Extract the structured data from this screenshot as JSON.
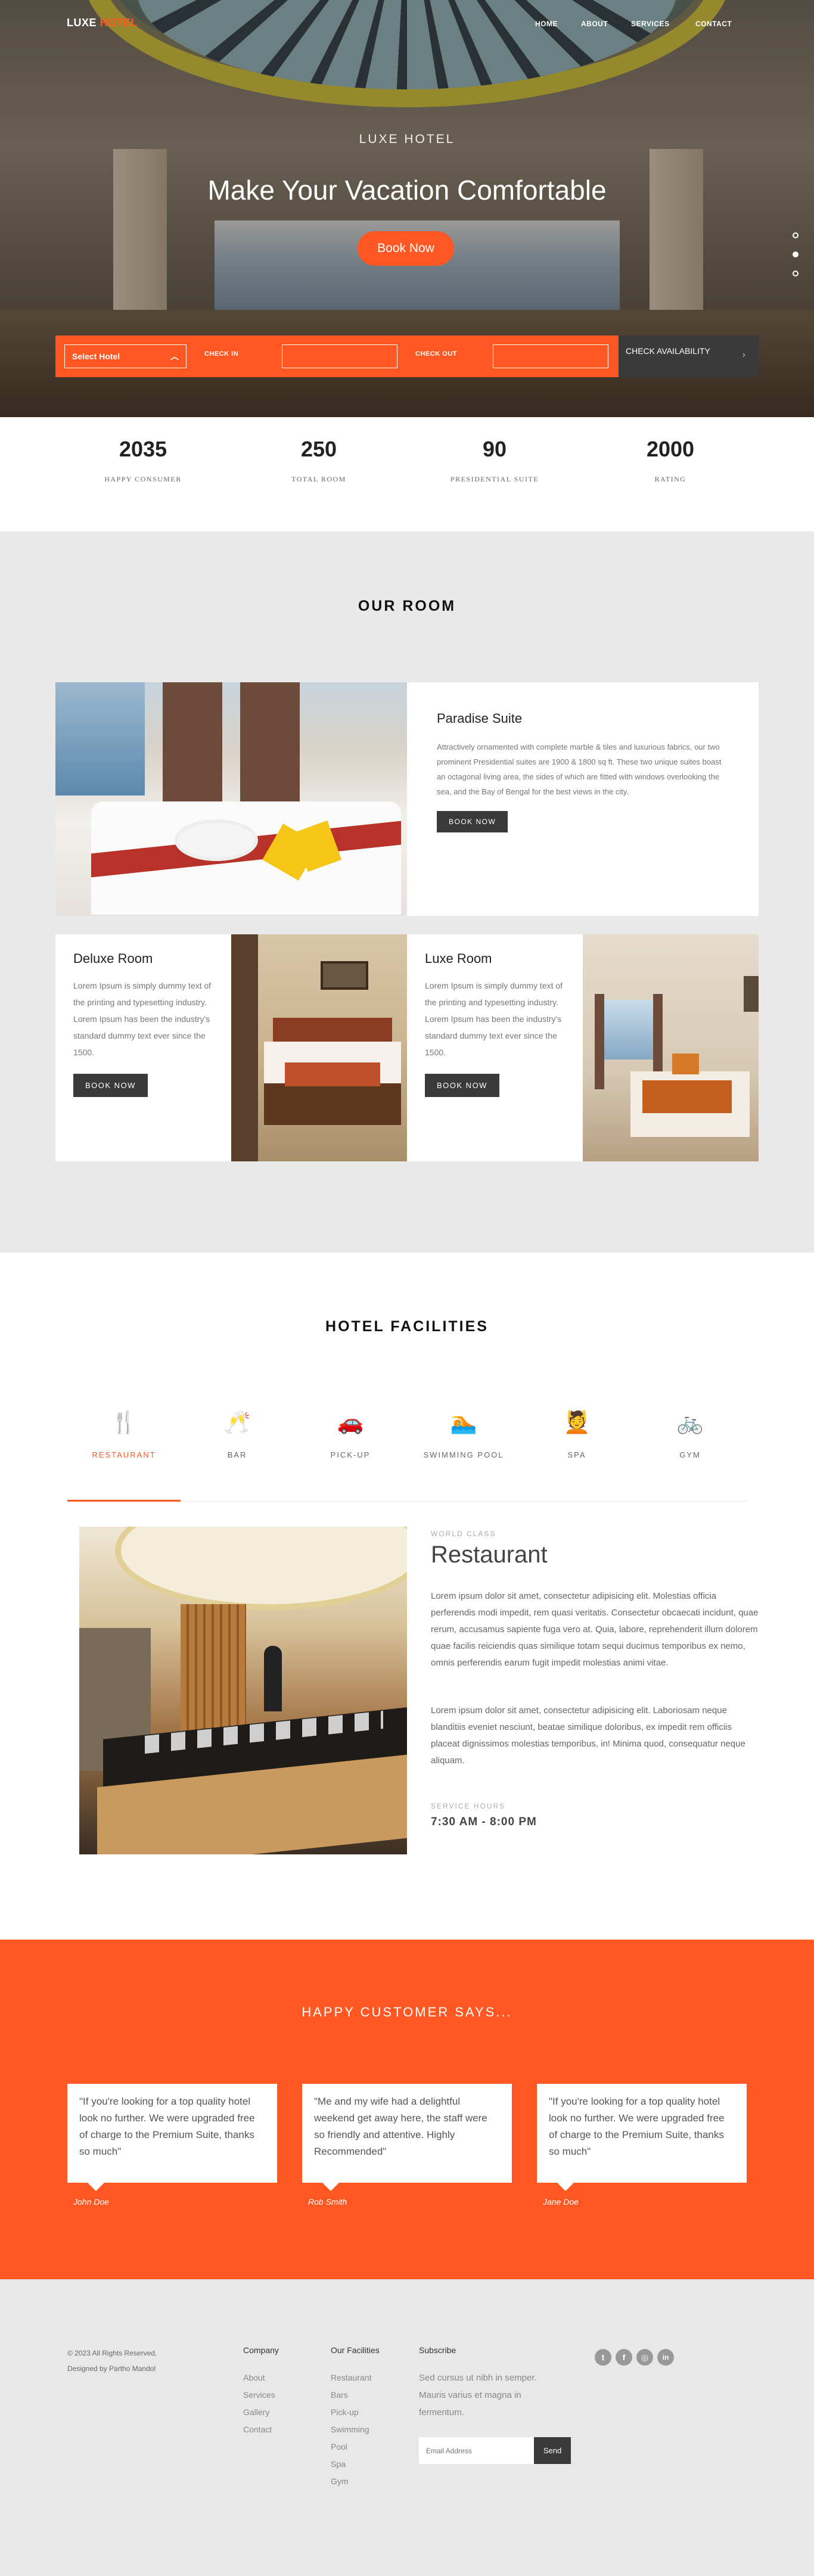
{
  "brand": {
    "name_part1": "LUXE",
    "name_part2": "HOTEL",
    "accent": "#ff5722",
    "dark": "#3a3a3a"
  },
  "nav": {
    "items": [
      "HOME",
      "ABOUT",
      "SERVICES",
      "CONTACT"
    ]
  },
  "hero": {
    "subtitle": "LUXE HOTEL",
    "title": "Make Your Vacation Comfortable",
    "cta": "Book Now",
    "slide_dots": 3,
    "active_dot": 2
  },
  "booking": {
    "select_hotel": "Select Hotel",
    "check_in_label": "CHECK IN",
    "check_out_label": "CHECK OUT",
    "check_availability": "CHECK AVAILABILITY"
  },
  "stats": [
    {
      "value": "2035",
      "label": "HAPPY CONSUMER"
    },
    {
      "value": "250",
      "label": "TOTAL ROOM"
    },
    {
      "value": "90",
      "label": "PRESIDENTIAL SUITE"
    },
    {
      "value": "2000",
      "label": "RATING"
    }
  ],
  "rooms": {
    "title": "OUR ROOM",
    "featured": {
      "name": "Paradise Suite",
      "desc": "Attractively ornamented with complete marble & tiles and luxurious fabrics, our two prominent Presidential suites are 1900 & 1800 sq ft. These two unique suites boast an octagonal living area, the sides of which are fitted with windows overlooking the sea, and the Bay of Bengal for the best views in the city.",
      "button": "BOOK NOW"
    },
    "items": [
      {
        "name": "Deluxe Room",
        "desc": "Lorem Ipsum is simply dummy text of the printing and typesetting industry. Lorem Ipsum has been the industry's standard dummy text ever since the 1500.",
        "button": "BOOK NOW"
      },
      {
        "name": "Luxe Room",
        "desc": "Lorem Ipsum is simply dummy text of the printing and typesetting industry. Lorem Ipsum has been the industry's standard dummy text ever since the 1500.",
        "button": "BOOK NOW"
      }
    ]
  },
  "facilities": {
    "title": "HOTEL FACILITIES",
    "tabs": [
      {
        "label": "RESTAURANT",
        "icon": "utensils-icon",
        "glyph": "🍴"
      },
      {
        "label": "BAR",
        "icon": "cheers-icon",
        "glyph": "🥂"
      },
      {
        "label": "PICK-UP",
        "icon": "car-icon",
        "glyph": "🚗"
      },
      {
        "label": "SWIMMING POOL",
        "icon": "swimmer-icon",
        "glyph": "🏊"
      },
      {
        "label": "SPA",
        "icon": "spa-icon",
        "glyph": "💆"
      },
      {
        "label": "GYM",
        "icon": "exercise-bike-icon",
        "glyph": "🚲"
      }
    ],
    "active_tab": 0,
    "detail": {
      "eyebrow": "WORLD CLASS",
      "title": "Restaurant",
      "p1": "Lorem ipsum dolor sit amet, consectetur adipisicing elit. Molestias officia perferendis modi impedit, rem quasi veritatis. Consectetur obcaecati incidunt, quae rerum, accusamus sapiente fuga vero at. Quia, labore, reprehenderit illum dolorem quae facilis reiciendis quas similique totam sequi ducimus temporibus ex nemo, omnis perferendis earum fugit impedit molestias animi vitae.",
      "p2": "Lorem ipsum dolor sit amet, consectetur adipisicing elit. Laboriosam neque blanditiis eveniet nesciunt, beatae similique doloribus, ex impedit rem officiis placeat dignissimos molestias temporibus, in! Minima quod, consequatur neque aliquam.",
      "hours_label": "SERVICE HOURS",
      "hours": "7:30 AM - 8:00 PM"
    }
  },
  "testimonials": {
    "title": "HAPPY CUSTOMER SAYS...",
    "items": [
      {
        "quote": "\"If you're looking for a top quality hotel look no further. We were upgraded free of charge to the Premium Suite, thanks so much\"",
        "name": "John Doe"
      },
      {
        "quote": "\"Me and my wife had a delightful weekend get away here, the staff were so friendly and attentive. Highly Recommended\"",
        "name": "Rob Smith"
      },
      {
        "quote": "\"If you're looking for a top quality hotel look no further. We were upgraded free of charge to the Premium Suite, thanks so much\"",
        "name": "Jane Doe"
      }
    ]
  },
  "footer": {
    "copyright": "© 2023 All Rights Reserved.",
    "designed_by": "Designed by Partho Mandol",
    "company": {
      "title": "Company",
      "links": [
        "About",
        "Services",
        "Gallery",
        "Contact"
      ]
    },
    "facilities": {
      "title": "Our Facilities",
      "links": [
        "Restaurant",
        "Bars",
        "Pick-up",
        "Swimming Pool",
        "Spa",
        "Gym"
      ]
    },
    "subscribe": {
      "title": "Subscribe",
      "text": "Sed cursus ut nibh in semper. Mauris varius et magna in fermentum.",
      "placeholder": "Email Address",
      "button": "Send"
    },
    "social": [
      {
        "icon": "twitter-icon",
        "glyph": "t"
      },
      {
        "icon": "facebook-icon",
        "glyph": "f"
      },
      {
        "icon": "instagram-icon",
        "glyph": "◎"
      },
      {
        "icon": "linkedin-icon",
        "glyph": "in"
      }
    ]
  }
}
